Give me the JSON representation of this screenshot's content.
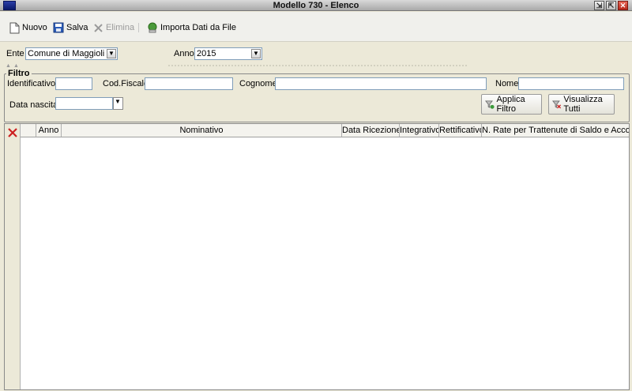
{
  "window": {
    "title": "Modello 730 - Elenco"
  },
  "toolbar": {
    "new_label": "Nuovo",
    "save_label": "Salva",
    "delete_label": "Elimina",
    "import_label": "Importa Dati da File"
  },
  "selectors": {
    "ente_label": "Ente",
    "ente_value": "Comune di Maggioli",
    "anno_label": "Anno",
    "anno_value": "2015"
  },
  "filter": {
    "legend": "Filtro",
    "identificativo_label": "Identificativo",
    "codfiscale_label": "Cod.Fiscale",
    "cognome_label": "Cognome",
    "nome_label": "Nome",
    "datanascita_label": "Data nascita",
    "apply_label": "Applica Filtro",
    "showall_label": "Visualizza Tutti"
  },
  "grid": {
    "columns": [
      "Anno",
      "Nominativo",
      "Data Ricezione",
      "Integrativo",
      "Rettificativo",
      "N. Rate per Trattenute di Saldo e Acconto"
    ],
    "rows": []
  },
  "colors": {
    "accent": "#0b1a6b",
    "delete_red": "#cc1f1f"
  }
}
